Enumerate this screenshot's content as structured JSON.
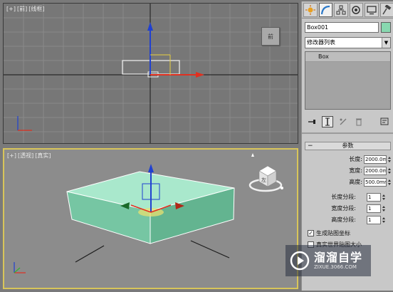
{
  "viewports": {
    "front": {
      "labels": [
        "[+]",
        "[前]",
        "[线框]"
      ],
      "viewcube_label": "前"
    },
    "perspective": {
      "labels": [
        "[+]",
        "[透视]",
        "[真实]"
      ],
      "viewcube_label": "左"
    }
  },
  "panel": {
    "tabs": [
      {
        "name": "create",
        "icon": "sun-icon"
      },
      {
        "name": "modify",
        "icon": "arc-icon"
      },
      {
        "name": "hierarchy",
        "icon": "hierarchy-icon"
      },
      {
        "name": "motion",
        "icon": "circle-icon"
      },
      {
        "name": "display",
        "icon": "monitor-icon"
      },
      {
        "name": "utilities",
        "icon": "hammer-icon"
      }
    ],
    "object_name": "Box001",
    "object_color": "#88d8b0",
    "modifier_list": "修改器列表",
    "stack_items": [
      "Box"
    ],
    "rollout_title": "参数",
    "params": [
      {
        "label": "长度:",
        "value": "2000.0mm"
      },
      {
        "label": "宽度:",
        "value": "2000.0mm"
      },
      {
        "label": "高度:",
        "value": "500.0mm"
      }
    ],
    "segments": [
      {
        "label": "长度分段:",
        "value": "1"
      },
      {
        "label": "宽度分段:",
        "value": "1"
      },
      {
        "label": "高度分段:",
        "value": "1"
      }
    ],
    "checkboxes": [
      {
        "label": "生成贴图坐标",
        "checked": true
      },
      {
        "label": "真实世界贴图大小",
        "checked": false
      }
    ]
  },
  "watermark": {
    "title": "溜溜自学",
    "url": "ZIXUE.3066.COM"
  },
  "colors": {
    "active_border": "#d8c55a",
    "box_color": "#88d8b0",
    "axis_x": "#e03020",
    "axis_y": "#30b030",
    "axis_z": "#2040d0"
  }
}
